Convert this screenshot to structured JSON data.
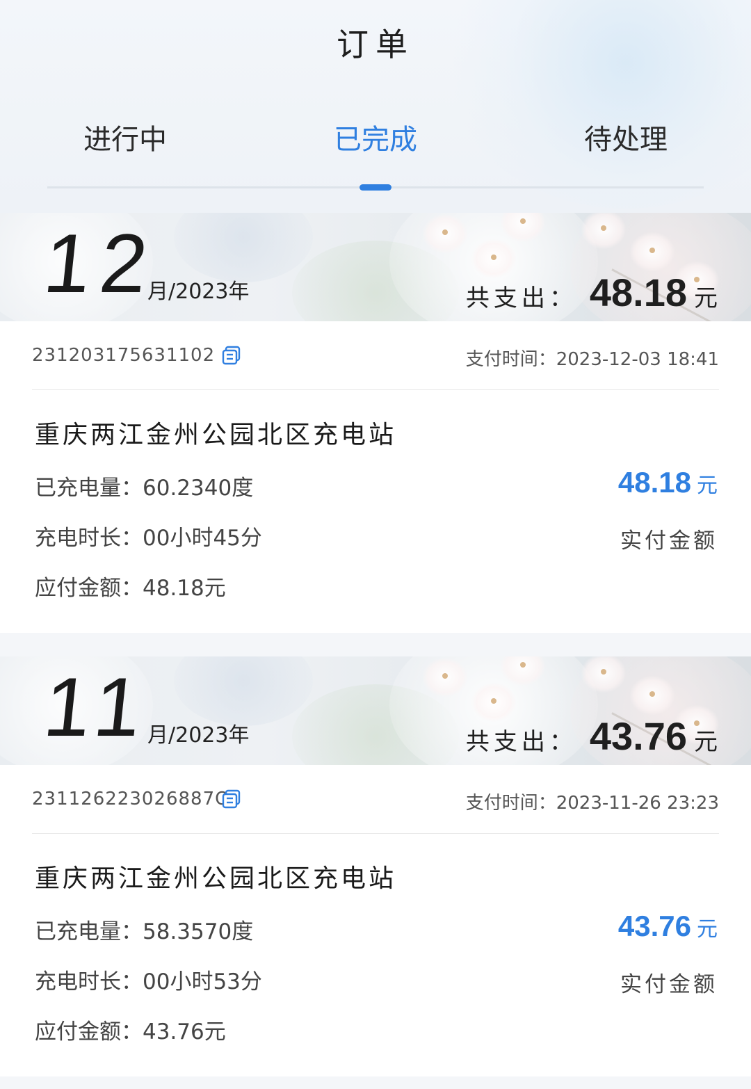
{
  "header": {
    "title": "订单",
    "tabs": [
      "进行中",
      "已完成",
      "待处理"
    ],
    "active_tab": 1
  },
  "colors": {
    "accent": "#2f7fe0",
    "text": "#1f1f1f",
    "muted": "#555555"
  },
  "orders": [
    {
      "month": "12",
      "month_year": "月/2023年",
      "total_label": "共支出：",
      "total_value": "48.18",
      "total_unit": "元",
      "order_no": "231203175631102",
      "pay_time": "支付时间：2023-12-03 18:41",
      "station": "重庆两江金州公园北区充电站",
      "charged": "已充电量：60.2340度",
      "duration": "充电时长：00小时45分",
      "payable": "应付金额：48.18元",
      "paid_value": "48.18",
      "paid_unit": "元",
      "paid_label": "实付金额"
    },
    {
      "month": "11",
      "month_year": "月/2023年",
      "total_label": "共支出：",
      "total_value": "43.76",
      "total_unit": "元",
      "order_no": "231126223026887O",
      "pay_time": "支付时间：2023-11-26 23:23",
      "station": "重庆两江金州公园北区充电站",
      "charged": "已充电量：58.3570度",
      "duration": "充电时长：00小时53分",
      "payable": "应付金额：43.76元",
      "paid_value": "43.76",
      "paid_unit": "元",
      "paid_label": "实付金额"
    }
  ]
}
